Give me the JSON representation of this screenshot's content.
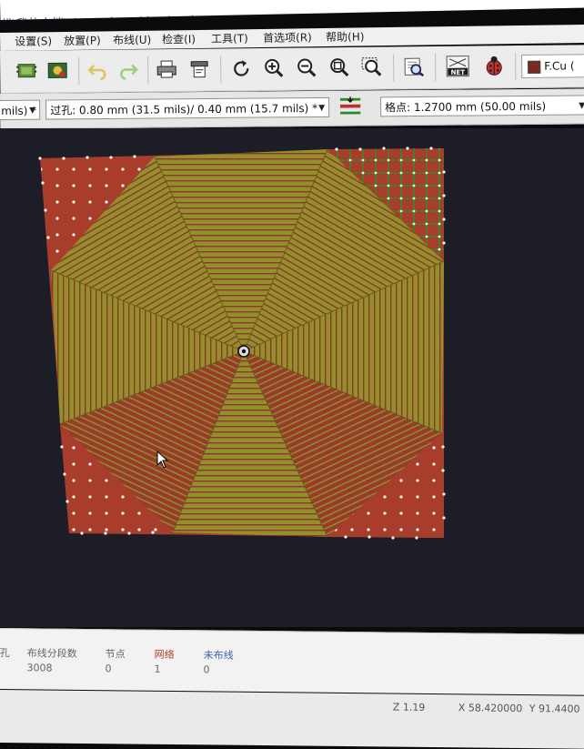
{
  "window": {
    "title": "代\\我的文档\\a\\wenxiang.kicad_pcb"
  },
  "menu": {
    "items": [
      "设置(S)",
      "放置(P)",
      "布线(U)",
      "检查(I)",
      "工具(T)",
      "首选项(R)",
      "帮助(H)"
    ]
  },
  "toolbar": {
    "buttons": [
      "load-footprint-icon",
      "3d-viewer-icon",
      "undo-icon",
      "redo-icon",
      "print-icon",
      "plot-icon",
      "refresh-icon",
      "zoom-in-icon",
      "zoom-out-icon",
      "zoom-fit-icon",
      "zoom-selection-icon",
      "find-icon",
      "netlist-icon",
      "drc-bug-icon"
    ],
    "netlist_label": "NET",
    "layer_select": "F.Cu (",
    "layer_color": "#7a2a22"
  },
  "options": {
    "track_width": "mils) *",
    "via_size": "过孔: 0.80 mm (31.5 mils)/ 0.40 mm (15.7 mils) *",
    "grid": "格点: 1.2700 mm (50.00 mils)"
  },
  "board": {
    "colors": {
      "copper_front": "#a83d2c",
      "copper_back": "#8f8a2c",
      "background": "#1d1d28"
    }
  },
  "status": {
    "columns": [
      {
        "label": "孔",
        "value": ""
      },
      {
        "label": "布线分段数",
        "value": "3008"
      },
      {
        "label": "节点",
        "value": "0"
      },
      {
        "label": "网络",
        "value": "1"
      },
      {
        "label": "未布线",
        "value": "0"
      }
    ]
  },
  "coords": {
    "zoom": "Z 1.19",
    "x": "X 58.420000",
    "y": "Y 91.4400"
  }
}
